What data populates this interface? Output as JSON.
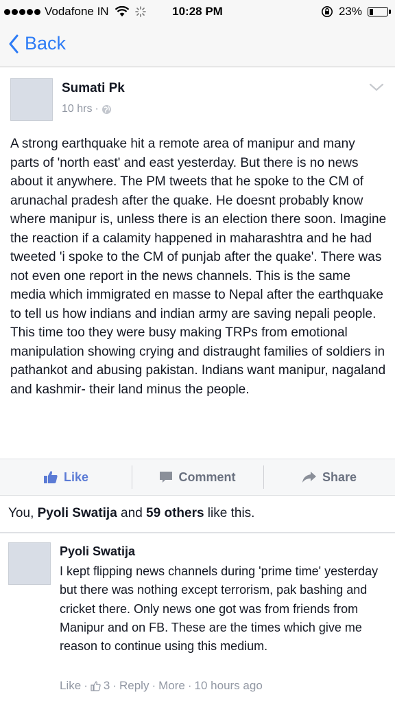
{
  "status_bar": {
    "carrier": "Vodafone IN",
    "time": "10:28 PM",
    "battery": "23%",
    "battery_level": 0.23
  },
  "nav": {
    "back_label": "Back"
  },
  "post": {
    "author": "Sumati Pk",
    "time": "10 hrs",
    "separator": "·",
    "text": "A strong earthquake hit a remote area of manipur and many parts of 'north east' and east yesterday. But there is no news about it anywhere. The PM tweets that he spoke to the CM of arunachal pradesh after the quake. He doesnt probably know where manipur is, unless there is an election there soon. Imagine the reaction if a calamity happened in maharashtra and he had tweeted 'i spoke to the CM of punjab after the quake'. There was not even one report in the news channels. This is the same media which immigrated en masse to Nepal after the earthquake to tell us how indians and indian army are saving nepali people. This time too they were busy making TRPs from emotional manipulation showing crying and distraught families of soldiers in pathankot and abusing pakistan. Indians want manipur, nagaland and kashmir- their land minus the people."
  },
  "actions": {
    "like": "Like",
    "comment": "Comment",
    "share": "Share"
  },
  "likes": {
    "prefix": "You, ",
    "name": "Pyoli Swatija",
    "middle": " and ",
    "others": "59 others",
    "suffix": " like this."
  },
  "comment": {
    "author": "Pyoli Swatija",
    "text": "I kept flipping news channels during 'prime time' yesterday but there was nothing except terrorism, pak bashing and cricket there. Only news one got was from friends from Manipur and on FB. These are the times which give me reason to continue using this medium.",
    "like_label": "Like",
    "like_count": "3",
    "reply_label": "Reply",
    "more_label": "More",
    "time": "10 hours ago",
    "separator": "·"
  },
  "colors": {
    "accent": "#2e7cf6",
    "like_blue": "#5b7bd5",
    "meta_gray": "#9197a3"
  }
}
